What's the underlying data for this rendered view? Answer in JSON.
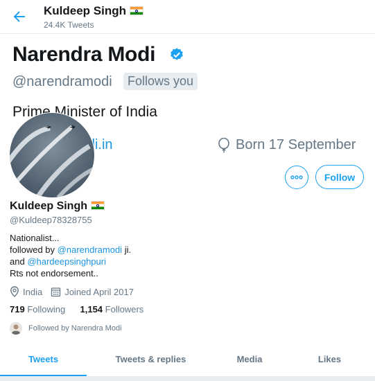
{
  "header": {
    "name": "Kuldeep Singh",
    "tweet_count": "24.4K Tweets"
  },
  "pinned_banner": {
    "name": "Narendra Modi",
    "handle": "@narendramodi",
    "follows_badge": "Follows you",
    "bio": "Prime Minister of India",
    "link": "narendramodi.in",
    "born": "Born 17 September"
  },
  "profile": {
    "name": "Kuldeep Singh",
    "handle": "@Kuldeep78328755",
    "bio_line1": "Nationalist...",
    "bio_line2_prefix": "followed by ",
    "bio_line2_link": "@narendramodi",
    "bio_line2_suffix": " ji.",
    "bio_line3_prefix": "and ",
    "bio_line3_link": "@hardeepsinghpuri",
    "bio_line4": "Rts not endorsement..",
    "location": "India",
    "joined": "Joined April 2017",
    "following_count": "719",
    "following_label": "Following",
    "followers_count": "1,154",
    "followers_label": "Followers",
    "followed_by": "Followed by Narendra Modi"
  },
  "actions": {
    "follow_label": "Follow"
  },
  "tabs": [
    {
      "label": "Tweets",
      "active": true
    },
    {
      "label": "Tweets & replies",
      "active": false
    },
    {
      "label": "Media",
      "active": false
    },
    {
      "label": "Likes",
      "active": false
    }
  ],
  "colors": {
    "accent": "#1da1f2",
    "link": "#1b95e0",
    "muted": "#657786"
  }
}
